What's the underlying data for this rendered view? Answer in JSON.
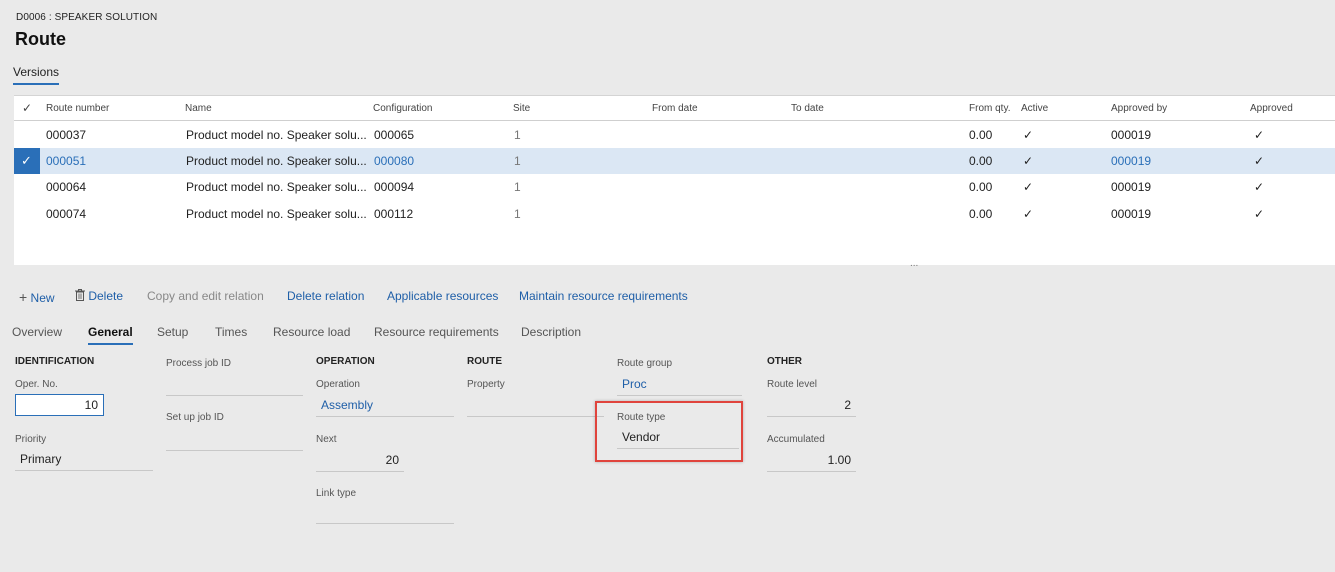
{
  "breadcrumb": "D0006 : SPEAKER SOLUTION",
  "title": "Route",
  "versions_tab": "Versions",
  "grid": {
    "columns": [
      "Route number",
      "Name",
      "Configuration",
      "Site",
      "From date",
      "To date",
      "From qty.",
      "Active",
      "Approved by",
      "Approved"
    ],
    "rows": [
      {
        "route_number": "000037",
        "name": "Product model no. Speaker solu...",
        "configuration": "000065",
        "site": "1",
        "from_qty": "0.00",
        "approved_by": "000019"
      },
      {
        "route_number": "000051",
        "name": "Product model no. Speaker solu...",
        "configuration": "000080",
        "site": "1",
        "from_qty": "0.00",
        "approved_by": "000019"
      },
      {
        "route_number": "000064",
        "name": "Product model no. Speaker solu...",
        "configuration": "000094",
        "site": "1",
        "from_qty": "0.00",
        "approved_by": "000019"
      },
      {
        "route_number": "000074",
        "name": "Product model no. Speaker solu...",
        "configuration": "000112",
        "site": "1",
        "from_qty": "0.00",
        "approved_by": "000019"
      }
    ],
    "check_glyph": "✓"
  },
  "ellipsis": "...",
  "toolbar": {
    "new_label": "New",
    "delete_label": "Delete",
    "copy_edit_label": "Copy and edit relation",
    "delete_relation_label": "Delete relation",
    "applicable_resources_label": "Applicable resources",
    "maintain_label": "Maintain resource requirements"
  },
  "tabs": [
    "Overview",
    "General",
    "Setup",
    "Times",
    "Resource load",
    "Resource requirements",
    "Description"
  ],
  "general": {
    "identification": {
      "heading": "IDENTIFICATION",
      "oper_no_label": "Oper. No.",
      "oper_no": "10",
      "priority_label": "Priority",
      "priority": "Primary"
    },
    "process": {
      "process_job_label": "Process job ID",
      "setup_job_label": "Set up job ID"
    },
    "operation": {
      "heading": "OPERATION",
      "operation_label": "Operation",
      "operation": "Assembly",
      "next_label": "Next",
      "next": "20",
      "link_type_label": "Link type"
    },
    "route": {
      "heading": "ROUTE",
      "property_label": "Property",
      "route_group_label": "Route group",
      "route_group": "Proc",
      "route_type_label": "Route type",
      "route_type": "Vendor"
    },
    "other": {
      "heading": "OTHER",
      "route_level_label": "Route level",
      "route_level": "2",
      "accumulated_label": "Accumulated",
      "accumulated": "1.00"
    }
  },
  "colors": {
    "accent": "#2a6fb8",
    "highlight": "#e0443d",
    "selected_row": "#dbe7f4"
  }
}
